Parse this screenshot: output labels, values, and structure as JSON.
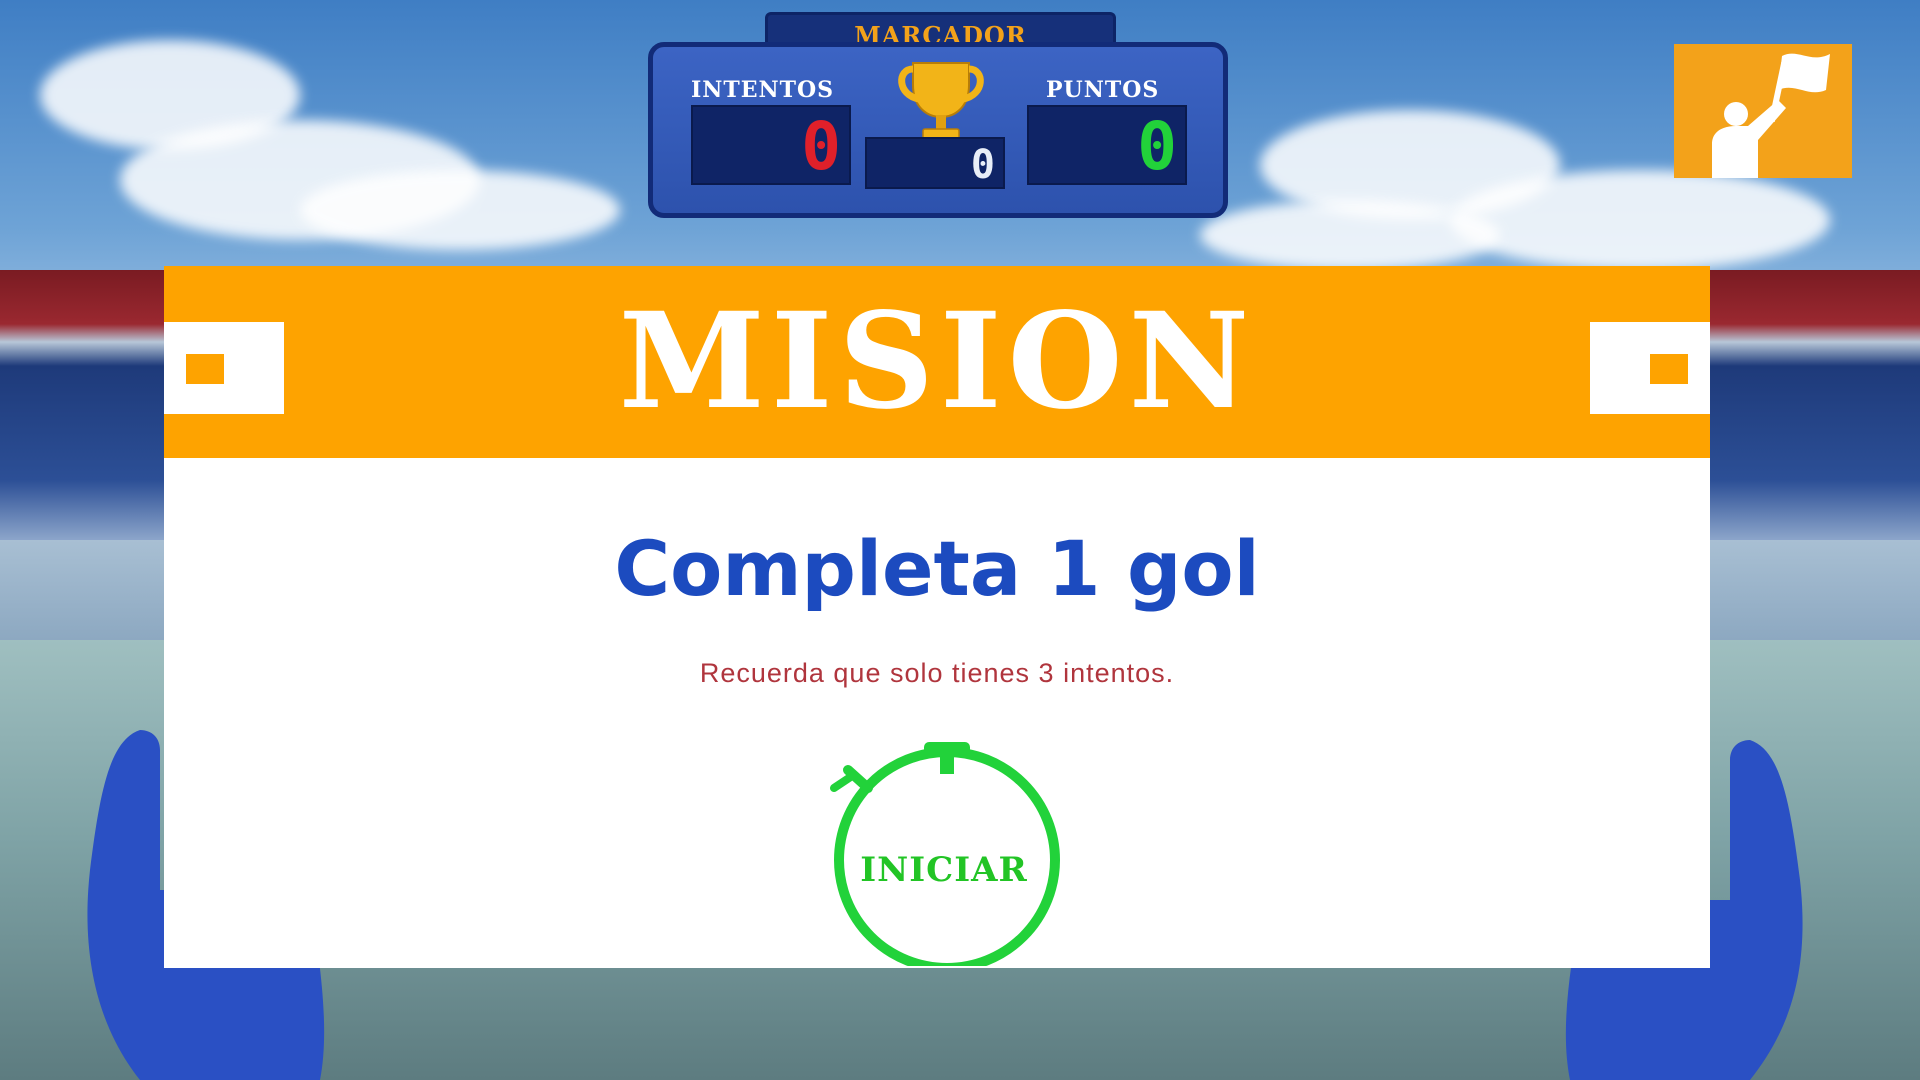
{
  "scoreboard": {
    "title": "MARCADOR",
    "attempts_label": "INTENTOS",
    "points_label": "PUNTOS",
    "attempts_value": "0",
    "center_value": "0",
    "points_value": "0"
  },
  "mission": {
    "title": "MISION",
    "objective": "Completa 1 gol",
    "hint": "Recuerda que solo tienes 3 intentos.",
    "start_label": "INICIAR"
  },
  "colors": {
    "accent_orange": "#fea300",
    "objective_blue": "#1c4bbf",
    "hint_red": "#b0353d",
    "start_green": "#22c425",
    "attempts_red": "#e0202a",
    "points_green": "#22d23a"
  },
  "icons": {
    "trophy": "trophy-icon",
    "referee_flag": "referee-flag-icon",
    "stopwatch": "stopwatch-icon"
  }
}
